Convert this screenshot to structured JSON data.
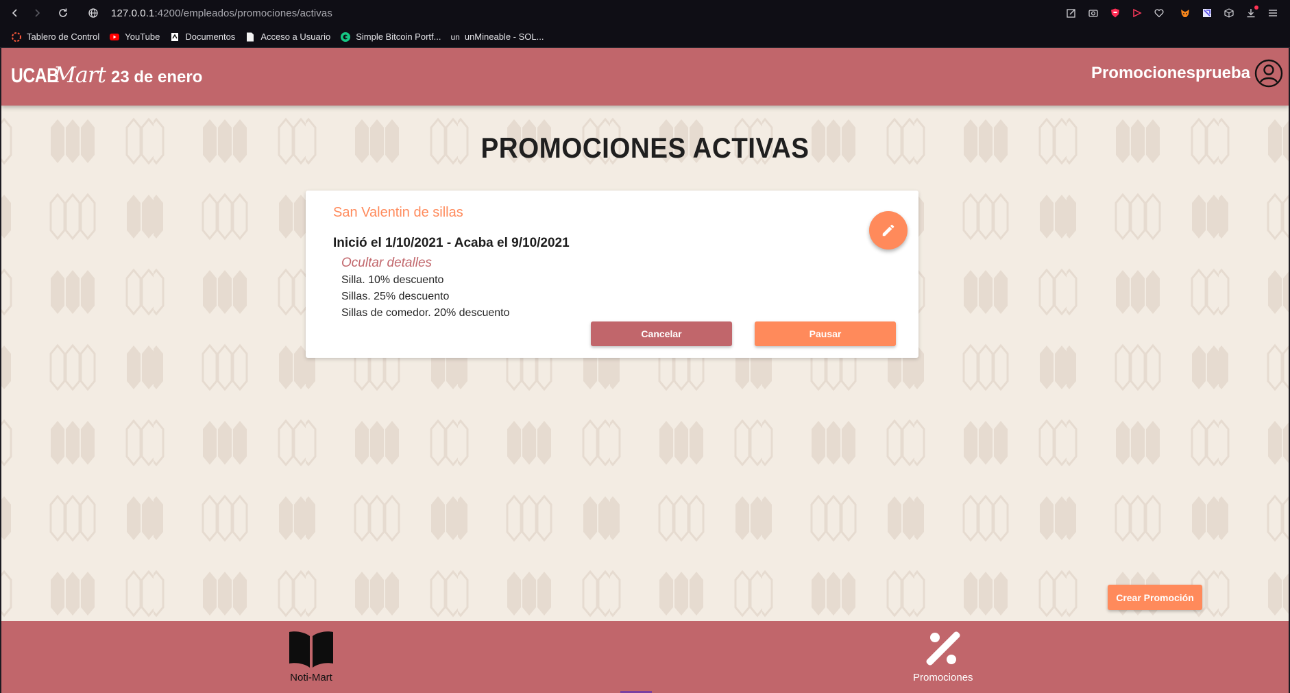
{
  "browser": {
    "url_host": "127.0.0.1",
    "url_path": ":4200/empleados/promociones/activas",
    "bookmarks": [
      {
        "label": "Tablero de Control",
        "icon": "spinner-icon"
      },
      {
        "label": "YouTube",
        "icon": "youtube-icon"
      },
      {
        "label": "Documentos",
        "icon": "document-icon"
      },
      {
        "label": "Acceso a Usuario",
        "icon": "file-icon"
      },
      {
        "label": "Simple Bitcoin Portf...",
        "icon": "bitcoin-icon"
      },
      {
        "label": "unMineable - SOL...",
        "icon": "unmineable-icon"
      }
    ],
    "unmineable_prefix": "un"
  },
  "header": {
    "brand_ucab": "UCAB",
    "brand_mart": "Mart",
    "date": "23 de enero",
    "username": "Promocionesprueba"
  },
  "main": {
    "title": "PROMOCIONES ACTIVAS"
  },
  "promotion": {
    "name": "San Valentin de sillas",
    "dates": "Inició el 1/10/2021 - Acaba el 9/10/2021",
    "toggle_label": "Ocultar detalles",
    "items": [
      "Silla. 10% descuento",
      "Sillas. 25% descuento",
      "Sillas de comedor. 20% descuento"
    ],
    "cancel_label": "Cancelar",
    "pause_label": "Pausar"
  },
  "create_button_label": "Crear Promoción",
  "footer": {
    "items": [
      {
        "label": "Noti-Mart",
        "icon": "book-icon"
      },
      {
        "label": "Promociones",
        "icon": "percent-icon"
      }
    ]
  },
  "colors": {
    "primary": "#c1666b",
    "accent": "#ff8a5b",
    "background": "#f3ece3"
  }
}
